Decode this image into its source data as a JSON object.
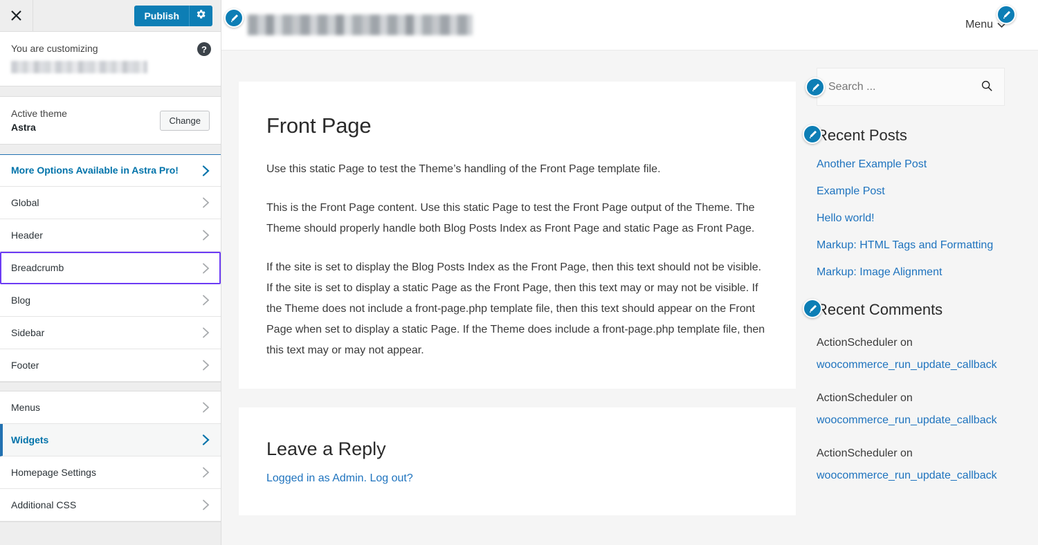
{
  "customizer": {
    "close_icon": "close-x-icon",
    "publish_label": "Publish",
    "gear_icon": "gear-icon",
    "help_icon": "help-icon",
    "customizing_label": "You are customizing",
    "site_title_blurred": "",
    "active_theme_label": "Active theme",
    "active_theme_name": "Astra",
    "change_label": "Change",
    "accent_color": "#0d7eb5",
    "focus_outline_color": "#6C3BF4",
    "active_color": "#0073aa",
    "sections_primary": [
      {
        "label": "More Options Available in Astra Pro!",
        "style": "pro"
      },
      {
        "label": "Global",
        "style": "normal"
      },
      {
        "label": "Header",
        "style": "normal"
      },
      {
        "label": "Breadcrumb",
        "style": "focused"
      },
      {
        "label": "Blog",
        "style": "normal"
      },
      {
        "label": "Sidebar",
        "style": "normal"
      },
      {
        "label": "Footer",
        "style": "normal"
      }
    ],
    "sections_secondary": [
      {
        "label": "Menus",
        "style": "normal"
      },
      {
        "label": "Widgets",
        "style": "active"
      },
      {
        "label": "Homepage Settings",
        "style": "normal"
      },
      {
        "label": "Additional CSS",
        "style": "normal"
      }
    ]
  },
  "preview": {
    "header": {
      "site_title_blurred": "",
      "menu_label": "Menu",
      "caret_icon": "chevron-down-icon",
      "edit_pin_icon": "edit-pencil-icon"
    },
    "page": {
      "title": "Front Page",
      "paragraphs": [
        "Use this static Page to test the Theme’s handling of the Front Page template file.",
        "This is the Front Page content. Use this static Page to test the Front Page output of the Theme. The Theme should properly handle both Blog Posts Index as Front Page and static Page as Front Page.",
        "If the site is set to display the Blog Posts Index as the Front Page, then this text should not be visible. If the site is set to display a static Page as the Front Page, then this text may or may not be visible. If the Theme does not include a front-page.php template file, then this text should appear on the Front Page when set to display a static Page. If the Theme does include a front-page.php template file, then this text may or may not appear."
      ]
    },
    "comments_form": {
      "title": "Leave a Reply",
      "logged_in_text": "Logged in as Admin.",
      "logout_label": "Log out?"
    },
    "sidebar": {
      "search": {
        "placeholder": "Search ...",
        "value": "",
        "icon": "search-icon"
      },
      "recent_posts": {
        "title": "Recent Posts",
        "items": [
          "Another Example Post",
          "Example Post",
          "Hello world!",
          "Markup: HTML Tags and Formatting",
          "Markup: Image Alignment"
        ]
      },
      "recent_comments": {
        "title": "Recent Comments",
        "items": [
          {
            "author": "ActionScheduler on",
            "link": "woocommerce_run_update_callback"
          },
          {
            "author": "ActionScheduler on",
            "link": "woocommerce_run_update_callback"
          },
          {
            "author": "ActionScheduler on",
            "link": "woocommerce_run_update_callback"
          }
        ]
      }
    }
  }
}
